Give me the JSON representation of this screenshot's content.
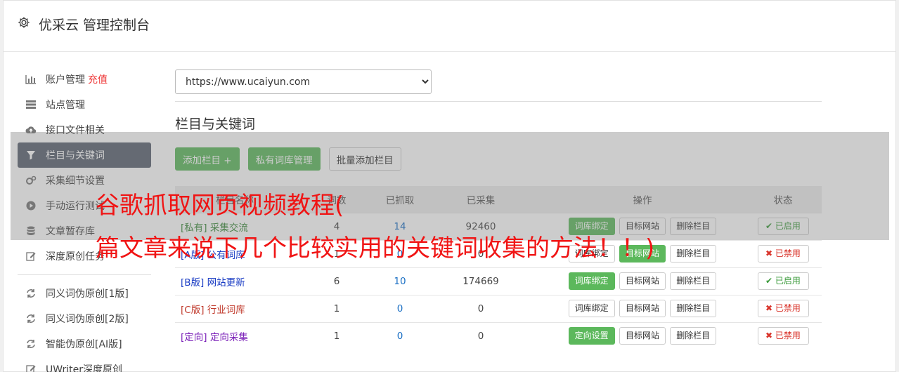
{
  "app": {
    "title": "优采云 管理控制台",
    "icon": "gear-icon"
  },
  "sidebar": {
    "items": [
      {
        "label": "账户管理",
        "badge": "充值",
        "icon": "bar-chart-icon"
      },
      {
        "label": "站点管理",
        "icon": "server-icon"
      },
      {
        "label": "接口文件相关",
        "icon": "cloud-upload-icon"
      },
      {
        "label": "栏目与关键词",
        "icon": "filter-icon",
        "active": true
      },
      {
        "label": "采集细节设置",
        "icon": "cogs-icon"
      },
      {
        "label": "手动运行测试",
        "icon": "play-circle-icon"
      },
      {
        "label": "文章暂存库",
        "icon": "database-icon"
      },
      {
        "label": "深度原创任务",
        "icon": "edit-icon"
      }
    ],
    "items2": [
      {
        "label": "同义词伪原创[1版]",
        "icon": "refresh-icon"
      },
      {
        "label": "同义词伪原创[2版]",
        "icon": "refresh-icon"
      },
      {
        "label": "智能伪原创[AI版]",
        "icon": "refresh-icon"
      },
      {
        "label": "UWriter深度原创",
        "icon": "edit-icon"
      }
    ]
  },
  "site_select": {
    "value": "https://www.ucaiyun.com"
  },
  "section": {
    "title": "栏目与关键词"
  },
  "buttons": {
    "add_column": "添加栏目 +",
    "private_lib": "私有词库管理",
    "batch_add": "批量添加栏目"
  },
  "table": {
    "headers": [
      "栏目名称",
      "词数",
      "已抓取",
      "已采集",
      "操作",
      "状态"
    ],
    "rows": [
      {
        "tag": "[私有]",
        "name": "采集交流",
        "c1": "4",
        "c2": "14",
        "c3": "92460",
        "op1": "词库绑定",
        "op1_green": true,
        "op2": "目标网站",
        "op3": "删除栏目",
        "status": "已启用",
        "on": true,
        "cls": "tag-s"
      },
      {
        "tag": "[A版]",
        "name": "公有词库",
        "c1": "1",
        "c2": "0",
        "c3": "0",
        "op1": "词库绑定",
        "op1_green": false,
        "op2": "目标网站",
        "op3": "删除栏目",
        "status": "已禁用",
        "on": false,
        "cls": "tag-a"
      },
      {
        "tag": "[B版]",
        "name": "网站更新",
        "c1": "6",
        "c2": "10",
        "c3": "174669",
        "op1": "词库绑定",
        "op1_green": true,
        "op2": "目标网站",
        "op3": "删除栏目",
        "status": "已启用",
        "on": true,
        "cls": "tag-a"
      },
      {
        "tag": "[C版]",
        "name": "行业词库",
        "c1": "1",
        "c2": "0",
        "c3": "0",
        "op1": "词库绑定",
        "op1_green": false,
        "op2": "目标网站",
        "op3": "删除栏目",
        "status": "已禁用",
        "on": false,
        "cls": "tag-c"
      },
      {
        "tag": "[定向]",
        "name": "定向采集",
        "c1": "1",
        "c2": "0",
        "c3": "0",
        "op1": "定向设置",
        "op1_green": true,
        "op2": "目标网站",
        "op3": "删除栏目",
        "status": "已禁用",
        "on": false,
        "cls": "tag-d"
      }
    ]
  },
  "overlay": {
    "line1": "谷歌抓取网页视频教程(",
    "line2": "篇文章来说下几个比较实用的关键词收集的方法！！)"
  },
  "colors": {
    "green": "#5cb85c",
    "active_nav": "#5a6170",
    "overlay_text": "#f01414"
  }
}
